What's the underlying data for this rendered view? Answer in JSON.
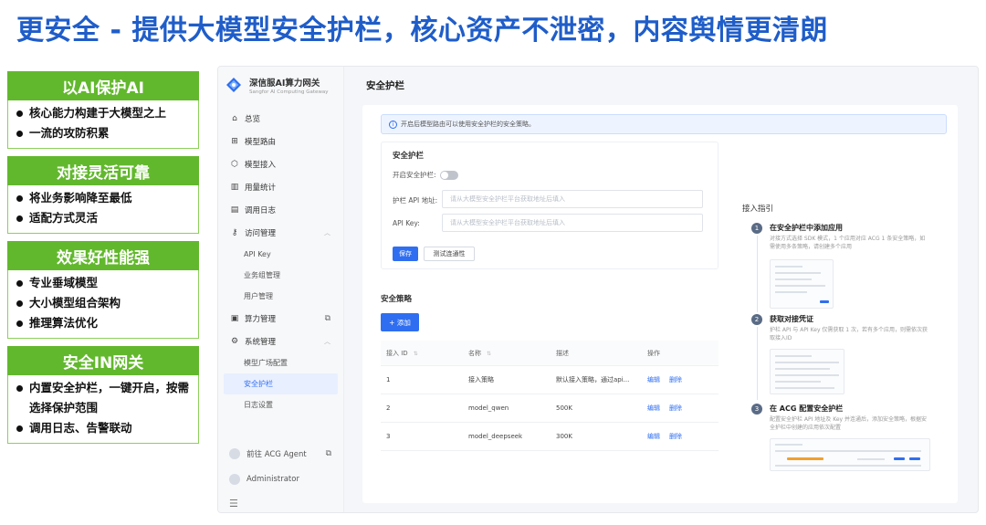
{
  "headline": "更安全 - 提供大模型安全护栏，核心资产不泄密，内容舆情更清朗",
  "features": [
    {
      "title": "以AI保护AI",
      "items": [
        "核心能力构建于大模型之上",
        "一流的攻防积累"
      ]
    },
    {
      "title": "对接灵活可靠",
      "items": [
        "将业务影响降至最低",
        "适配方式灵活"
      ]
    },
    {
      "title": "效果好性能强",
      "items": [
        "专业垂域模型",
        "大小模型组合架构",
        "推理算法优化"
      ]
    },
    {
      "title": "安全IN网关",
      "items": [
        "内置安全护栏，一键开启，按需选择保护范围",
        "调用日志、告警联动"
      ]
    }
  ],
  "app": {
    "brand": {
      "name": "深信服AI算力网关",
      "sub": "Sangfor AI Computing Gateway"
    },
    "nav": [
      {
        "icon": "⌂",
        "icon_name": "home-icon",
        "label": "总览"
      },
      {
        "icon": "⊞",
        "icon_name": "route-icon",
        "label": "模型路由"
      },
      {
        "icon": "⬡",
        "icon_name": "cube-icon",
        "label": "模型接入"
      },
      {
        "icon": "▥",
        "icon_name": "bar-chart-icon",
        "label": "用量统计"
      },
      {
        "icon": "▤",
        "icon_name": "document-icon",
        "label": "调用日志"
      }
    ],
    "access": {
      "icon": "⚷",
      "label": "访问管理",
      "subs": [
        "API Key",
        "业务组管理",
        "用户管理"
      ]
    },
    "compute": {
      "icon": "▣",
      "label": "算力管理"
    },
    "system": {
      "icon": "⚙",
      "label": "系统管理",
      "subs": [
        "模型广场配置",
        "安全护栏",
        "日志设置"
      ]
    },
    "bottom": {
      "agent": "前往 ACG Agent",
      "user": "Administrator",
      "collapse": "☰"
    },
    "page_title": "安全护栏",
    "notice": "开启后模型路由可以使用安全护栏的安全策略。",
    "guard": {
      "title": "安全护栏",
      "enable_label": "开启安全护栏:",
      "enabled": false,
      "api_addr_label": "护栏 API 地址:",
      "api_addr_placeholder": "请从大模型安全护栏平台获取地址后填入",
      "api_key_label": "API Key:",
      "api_key_placeholder": "请从大模型安全护栏平台获取地址后填入",
      "save": "保存",
      "test": "测试连通性"
    },
    "policy": {
      "title": "安全策略",
      "add": "+ 添加",
      "columns": [
        "接入 ID",
        "名称",
        "描述",
        "操作"
      ],
      "rows": [
        {
          "id": "1",
          "name": "接入策略",
          "desc": "默认接入策略，通过api...",
          "edit": "编辑",
          "del": "删除"
        },
        {
          "id": "2",
          "name": "model_qwen",
          "desc": "500K",
          "edit": "编辑",
          "del": "删除"
        },
        {
          "id": "3",
          "name": "model_deepseek",
          "desc": "300K",
          "edit": "编辑",
          "del": "删除"
        }
      ]
    },
    "guide": {
      "title": "接入指引",
      "steps": [
        {
          "num": "1",
          "title": "在安全护栏中添加应用",
          "desc": "对接方式选择 SDK 模式，1 个应用对应 ACG 1 条安全策略，如需使用多条策略，请创建多个应用"
        },
        {
          "num": "2",
          "title": "获取对接凭证",
          "desc": "护栏 API 与 API Key 仅需获取 1 次，若有多个应用，则需依次获取接入ID"
        },
        {
          "num": "3",
          "title": "在 ACG 配置安全护栏",
          "desc": "配置安全护栏 API 地址及 Key 并连通后，添加安全策略，根据安全护栏中创建的应用依次配置"
        }
      ]
    }
  }
}
